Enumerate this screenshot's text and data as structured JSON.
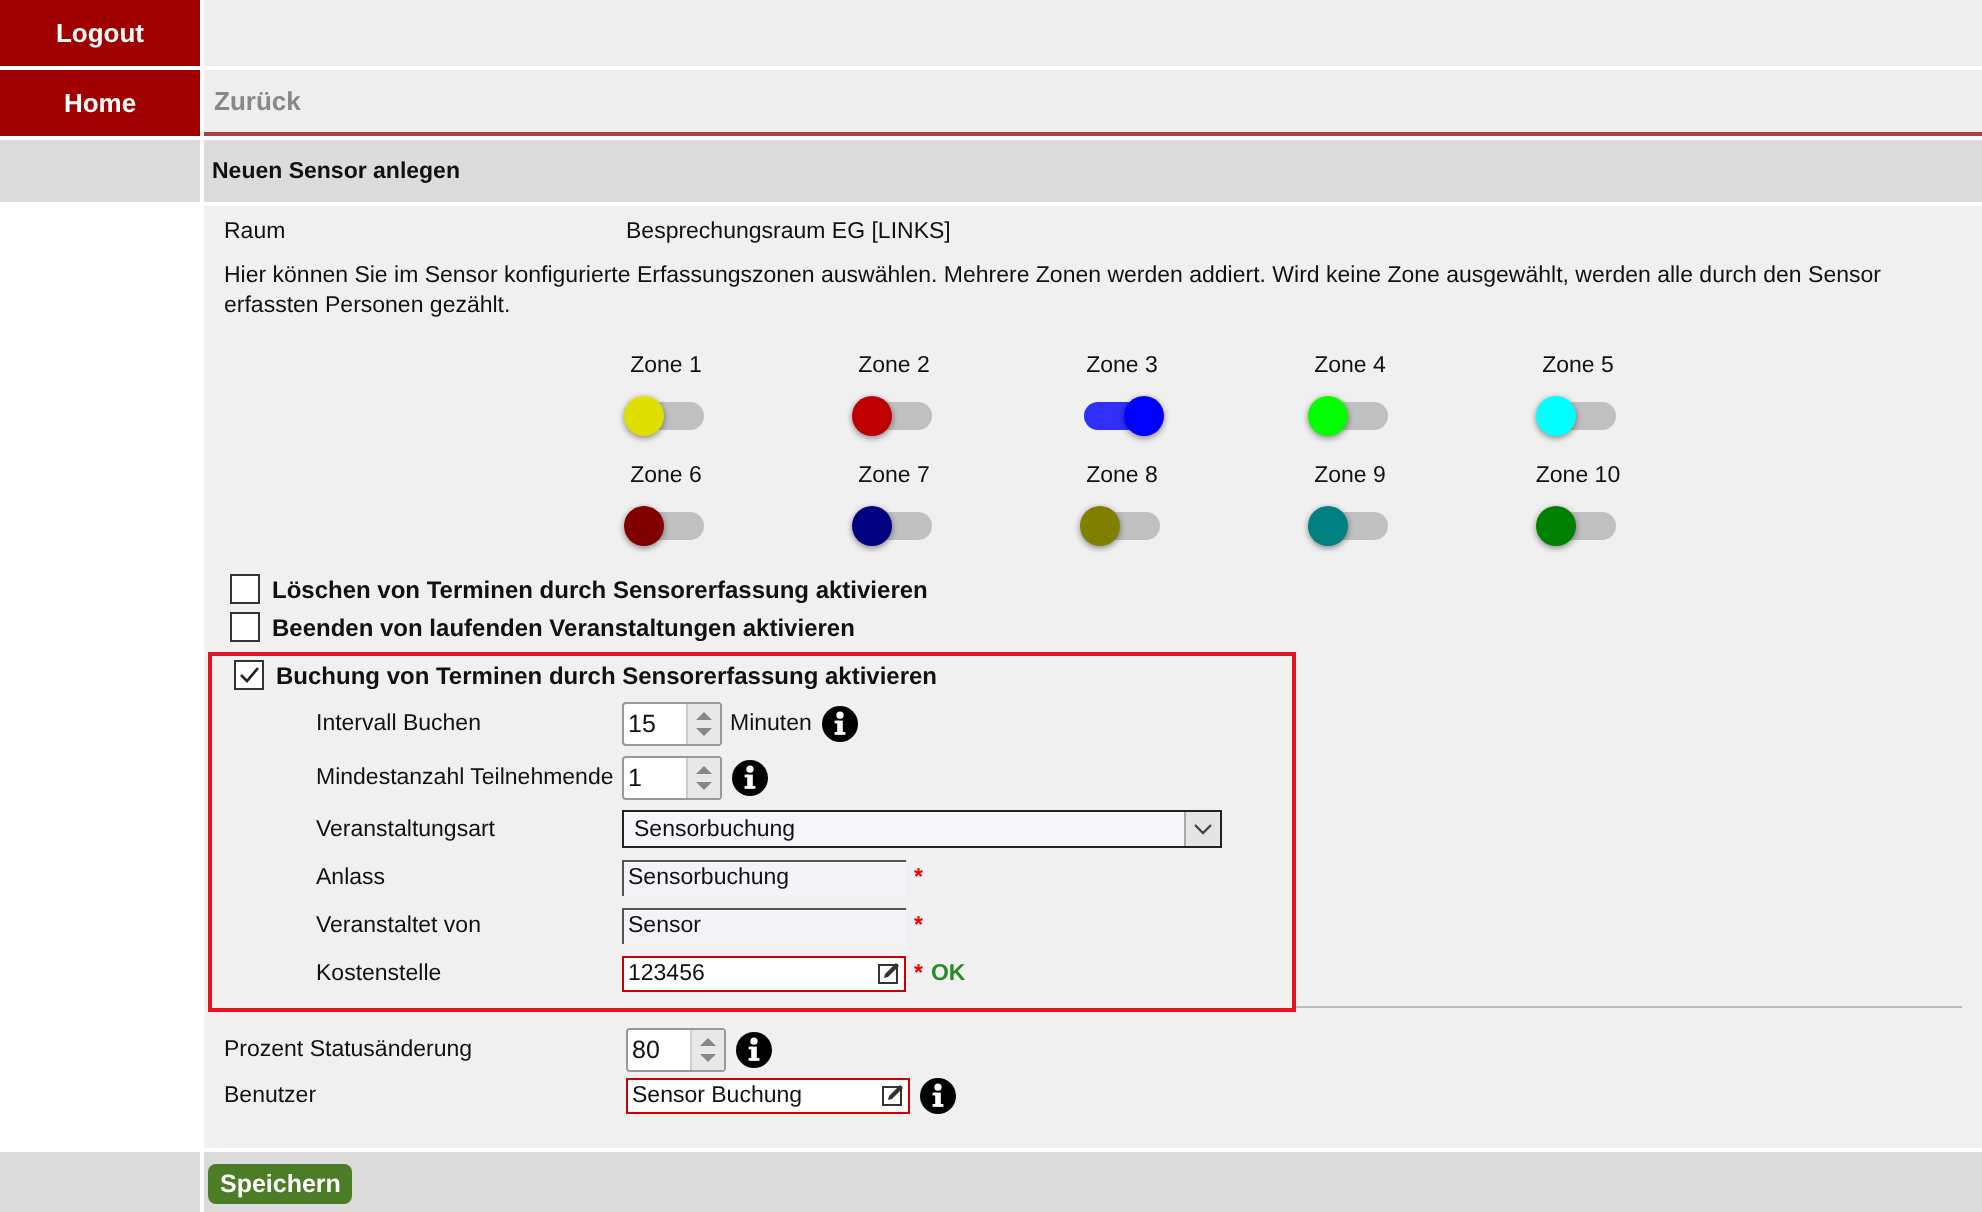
{
  "nav": {
    "logout": "Logout",
    "home": "Home",
    "back": "Zurück"
  },
  "section_title": "Neuen Sensor anlegen",
  "room": {
    "label": "Raum",
    "value": "Besprechungsraum EG [LINKS]"
  },
  "hint": "Hier können Sie im Sensor konfigurierte Erfassungszonen auswählen. Mehrere Zonen werden addiert. Wird keine Zone ausgewählt, werden alle durch den Sensor erfassten Personen gezählt.",
  "zones": [
    {
      "label": "Zone 1",
      "color": "#e0e000",
      "on": false
    },
    {
      "label": "Zone 2",
      "color": "#c00000",
      "on": false
    },
    {
      "label": "Zone 3",
      "color": "#0000ff",
      "on": true
    },
    {
      "label": "Zone 4",
      "color": "#00ff00",
      "on": false
    },
    {
      "label": "Zone 5",
      "color": "#00ffff",
      "on": false
    },
    {
      "label": "Zone 6",
      "color": "#800000",
      "on": false
    },
    {
      "label": "Zone 7",
      "color": "#000080",
      "on": false
    },
    {
      "label": "Zone 8",
      "color": "#808000",
      "on": false
    },
    {
      "label": "Zone 9",
      "color": "#008080",
      "on": false
    },
    {
      "label": "Zone 10",
      "color": "#008000",
      "on": false
    }
  ],
  "options": [
    {
      "label": "Löschen von Terminen durch Sensorerfassung aktivieren",
      "checked": false
    },
    {
      "label": "Beenden von laufenden Veranstaltungen aktivieren",
      "checked": false
    }
  ],
  "booking": {
    "label": "Buchung von Terminen durch Sensorerfassung aktivieren",
    "checked": true,
    "fields": [
      {
        "kind": "spinner",
        "label": "Intervall Buchen",
        "value": "15",
        "unit": "Minuten",
        "info": true
      },
      {
        "kind": "spinner",
        "label": "Mindestanzahl Teilnehmende",
        "value": "1",
        "info": true
      },
      {
        "kind": "select",
        "label": "Veranstaltungsart",
        "value": "Sensorbuchung"
      },
      {
        "kind": "text",
        "label": "Anlass",
        "value": "Sensorbuchung",
        "mark": "*"
      },
      {
        "kind": "text",
        "label": "Veranstaltet von",
        "value": "Sensor",
        "mark": "*"
      },
      {
        "kind": "lookup",
        "label": "Kostenstelle",
        "value": "123456",
        "mark": "*",
        "status": "OK"
      }
    ]
  },
  "settings": [
    {
      "kind": "spinner",
      "label": "Prozent Statusänderung",
      "value": "80",
      "info": true
    },
    {
      "kind": "lookup",
      "label": "Benutzer",
      "value": "Sensor Buchung",
      "info": true
    }
  ],
  "save_button": "Speichern"
}
